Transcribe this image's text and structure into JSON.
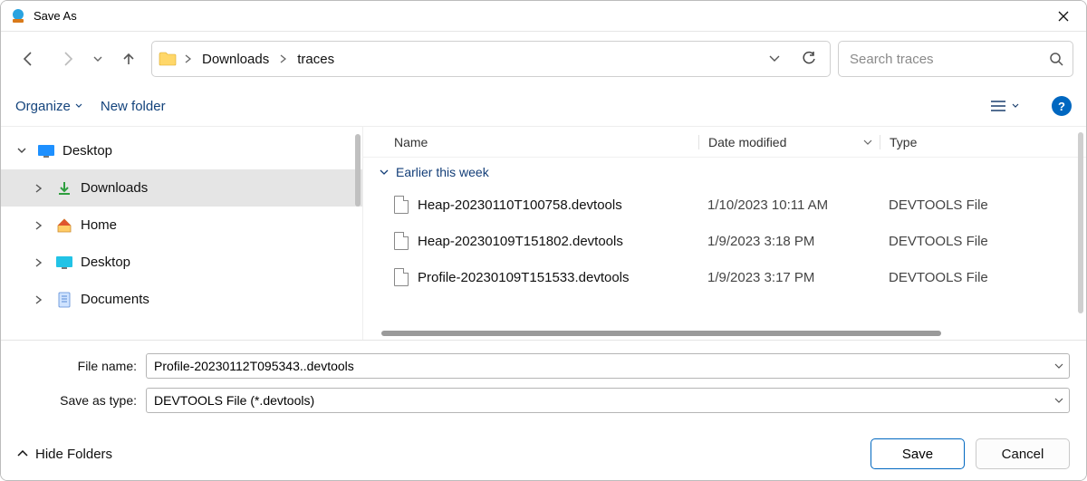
{
  "window": {
    "title": "Save As"
  },
  "breadcrumb": {
    "items": [
      "Downloads",
      "traces"
    ]
  },
  "search": {
    "placeholder": "Search traces"
  },
  "toolbar": {
    "organize": "Organize",
    "new_folder": "New folder",
    "help_icon": "?"
  },
  "sidebar": {
    "items": [
      {
        "label": "Desktop",
        "icon": "desktop-blue",
        "expanded": true,
        "indent": false,
        "selected": false
      },
      {
        "label": "Downloads",
        "icon": "download",
        "expanded": false,
        "indent": true,
        "selected": true
      },
      {
        "label": "Home",
        "icon": "home",
        "expanded": false,
        "indent": true,
        "selected": false
      },
      {
        "label": "Desktop",
        "icon": "desktop-cyan",
        "expanded": false,
        "indent": true,
        "selected": false
      },
      {
        "label": "Documents",
        "icon": "document",
        "expanded": false,
        "indent": true,
        "selected": false
      }
    ]
  },
  "columns": {
    "name": "Name",
    "date": "Date modified",
    "type": "Type"
  },
  "group": {
    "label": "Earlier this week"
  },
  "files": [
    {
      "name": "Heap-20230110T100758.devtools",
      "date": "1/10/2023 10:11 AM",
      "type": "DEVTOOLS File"
    },
    {
      "name": "Heap-20230109T151802.devtools",
      "date": "1/9/2023 3:18 PM",
      "type": "DEVTOOLS File"
    },
    {
      "name": "Profile-20230109T151533.devtools",
      "date": "1/9/2023 3:17 PM",
      "type": "DEVTOOLS File"
    }
  ],
  "form": {
    "file_name_label": "File name:",
    "file_name_value": "Profile-20230112T095343..devtools",
    "save_type_label": "Save as type:",
    "save_type_value": "DEVTOOLS File (*.devtools)"
  },
  "footer": {
    "hide_folders": "Hide Folders",
    "save": "Save",
    "cancel": "Cancel"
  }
}
